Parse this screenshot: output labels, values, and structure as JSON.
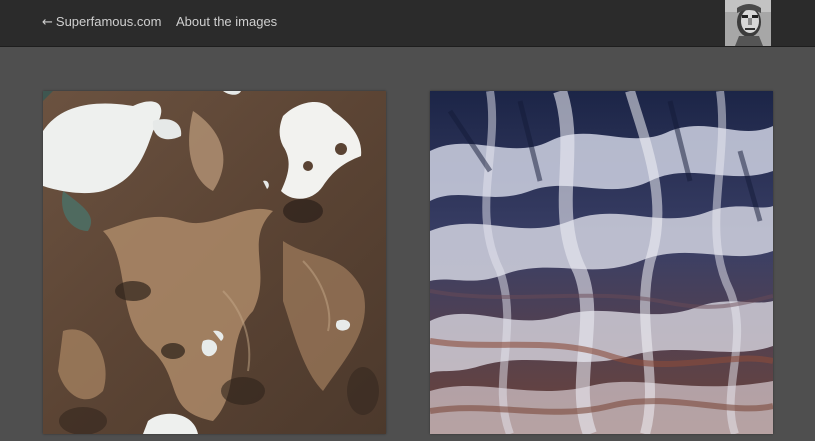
{
  "nav": {
    "back_arrow": "←",
    "back_label": "Superfamous.com",
    "about_label": "About the images"
  },
  "avatar": {
    "icon": "statue-head-avatar"
  },
  "gallery": {
    "items": [
      {
        "name": "aerial-terrain-lakes",
        "palette": {
          "ground": "#5a4333",
          "sand": "#b08e6e",
          "ice": "#eef0ee",
          "water": "#4f6a5f"
        }
      },
      {
        "name": "aerial-snowy-ridges",
        "palette": {
          "ridge": "#d8d8e6",
          "shadow": "#1f2a4f",
          "earth": "#7b4a3c"
        }
      }
    ]
  }
}
